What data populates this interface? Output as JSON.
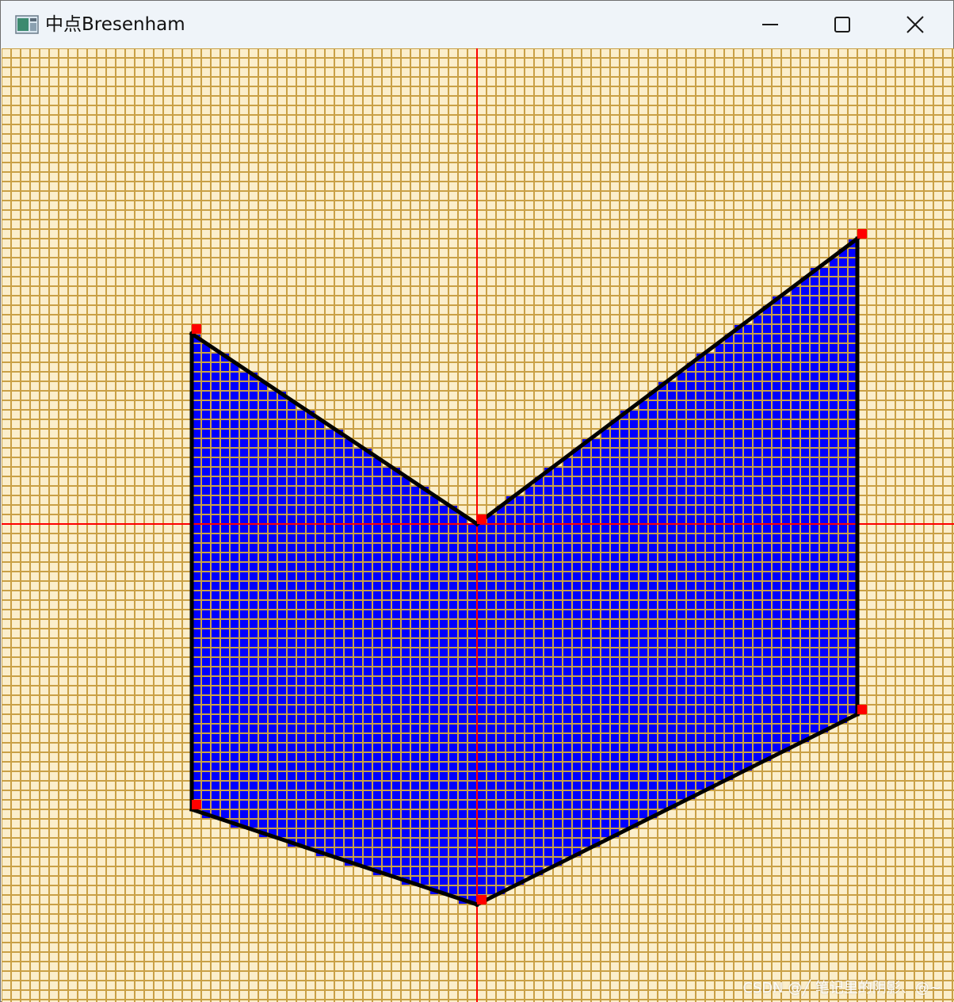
{
  "window": {
    "title": "中点Bresenham",
    "controls": {
      "minimize": "minimize-icon",
      "maximize": "maximize-icon",
      "close": "close-icon"
    }
  },
  "canvas": {
    "background_color": "#fbeecb",
    "grid_color": "#c9a046",
    "axis_color": "#ff0000",
    "fill_color": "#0000ff",
    "edge_color": "#000000",
    "vertex_color": "#ff0000",
    "vertices": [
      [
        -30,
        20
      ],
      [
        0,
        0
      ],
      [
        40,
        30
      ],
      [
        40,
        -20
      ],
      [
        0,
        -40
      ],
      [
        -30,
        -30
      ]
    ]
  },
  "watermark": "CSDN @╱ 笔记里的阴影、@~"
}
